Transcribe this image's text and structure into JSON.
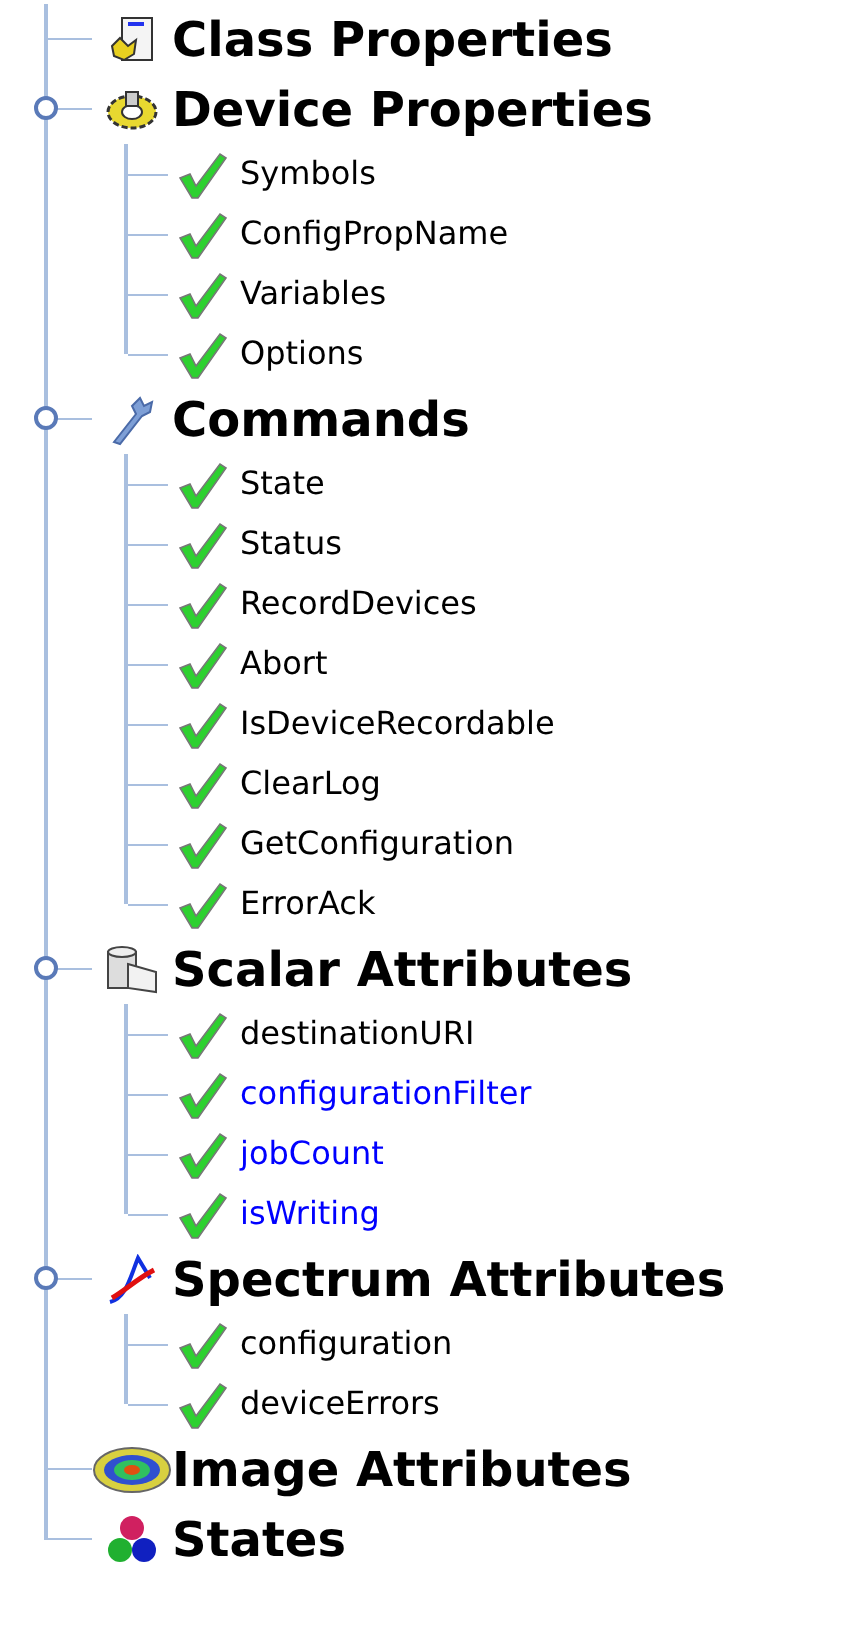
{
  "tree": [
    {
      "label": "Class Properties",
      "kind": "class"
    },
    {
      "label": "Device Properties",
      "kind": "device",
      "expanded": true,
      "children": [
        {
          "label": "Symbols",
          "color": "#000000"
        },
        {
          "label": "ConfigPropName",
          "color": "#000000"
        },
        {
          "label": "Variables",
          "color": "#000000"
        },
        {
          "label": "Options",
          "color": "#000000"
        }
      ]
    },
    {
      "label": "Commands",
      "kind": "commands",
      "expanded": true,
      "children": [
        {
          "label": "State",
          "color": "#000000"
        },
        {
          "label": "Status",
          "color": "#000000"
        },
        {
          "label": "RecordDevices",
          "color": "#000000"
        },
        {
          "label": "Abort",
          "color": "#000000"
        },
        {
          "label": "IsDeviceRecordable",
          "color": "#000000"
        },
        {
          "label": "ClearLog",
          "color": "#000000"
        },
        {
          "label": "GetConfiguration",
          "color": "#000000"
        },
        {
          "label": "ErrorAck",
          "color": "#000000"
        }
      ]
    },
    {
      "label": "Scalar Attributes",
      "kind": "scalar",
      "expanded": true,
      "children": [
        {
          "label": "destinationURI",
          "color": "#000000"
        },
        {
          "label": "configurationFilter",
          "color": "#0000ff"
        },
        {
          "label": "jobCount",
          "color": "#0000ff"
        },
        {
          "label": "isWriting",
          "color": "#0000ff"
        }
      ]
    },
    {
      "label": "Spectrum Attributes",
      "kind": "spectrum",
      "expanded": true,
      "children": [
        {
          "label": "configuration",
          "color": "#000000"
        },
        {
          "label": "deviceErrors",
          "color": "#000000"
        }
      ]
    },
    {
      "label": "Image Attributes",
      "kind": "image"
    },
    {
      "label": "States",
      "kind": "states"
    }
  ]
}
